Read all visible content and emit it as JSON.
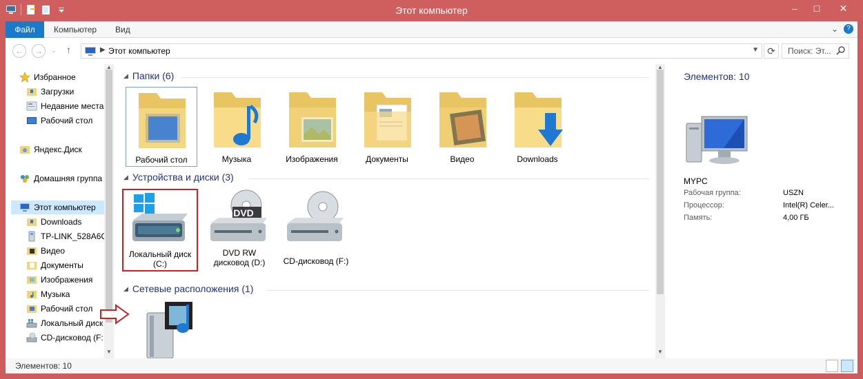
{
  "window": {
    "title": "Этот компьютер"
  },
  "ribbon": {
    "tabs": [
      "Файл",
      "Компьютер",
      "Вид"
    ]
  },
  "address": {
    "path": "Этот компьютер",
    "search_placeholder": "Поиск: Эт..."
  },
  "nav": {
    "favorites_label": "Избранное",
    "favorites": [
      "Загрузки",
      "Недавние места",
      "Рабочий стол"
    ],
    "yandex": "Яндекс.Диск",
    "homegroup": "Домашняя группа",
    "computer": "Этот компьютер",
    "computer_items": [
      "Downloads",
      "TP-LINK_528A6C",
      "Видео",
      "Документы",
      "Изображения",
      "Музыка",
      "Рабочий стол",
      "Локальный диск",
      "CD-дисковод (F:"
    ]
  },
  "main": {
    "folders_header": "Папки (6)",
    "folders": [
      "Рабочий стол",
      "Музыка",
      "Изображения",
      "Документы",
      "Видео",
      "Downloads"
    ],
    "devices_header": "Устройства и диски (3)",
    "drives": [
      {
        "label1": "Локальный диск",
        "label2": "(C:)"
      },
      {
        "label1": "DVD RW",
        "label2": "дисковод (D:)"
      },
      {
        "label1": "CD-дисковод (F:)",
        "label2": ""
      }
    ],
    "dvd_badge": "DVD",
    "network_header": "Сетевые расположения (1)"
  },
  "details": {
    "count": "Элементов: 10",
    "pc_name": "MYPC",
    "props": [
      {
        "k": "Рабочая группа:",
        "v": "USZN"
      },
      {
        "k": "Процессор:",
        "v": "Intel(R) Celer..."
      },
      {
        "k": "Память:",
        "v": "4,00 ГБ"
      }
    ]
  },
  "status": {
    "text": "Элементов: 10"
  },
  "colors": {
    "titlebar": "#cf5f5f",
    "file_tab": "#1979ca",
    "group_header": "#1e3287",
    "highlight_box": "#d01f1f"
  }
}
